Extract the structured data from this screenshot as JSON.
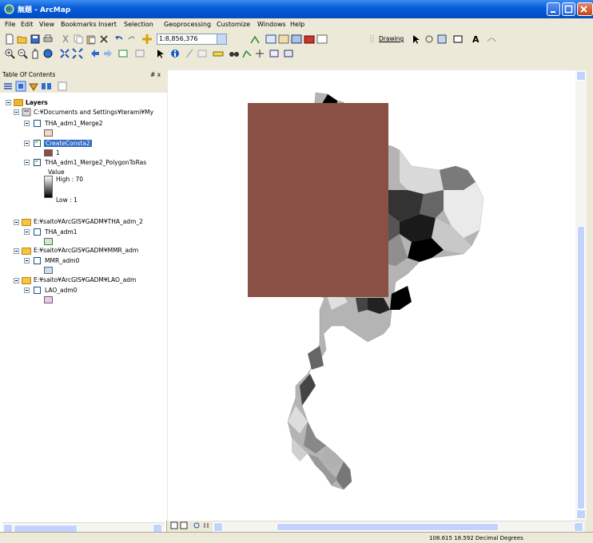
{
  "window": {
    "title": "無題 - ArcMap",
    "colors": {
      "titlebar": "#0a5fd9",
      "selection": "#316ac5",
      "raster": "#8b5045"
    }
  },
  "menu": [
    "File",
    "Edit",
    "View",
    "Bookmarks",
    "Insert",
    "Selection",
    "Geoprocessing",
    "Customize",
    "Windows",
    "Help"
  ],
  "toolbar": {
    "scale": "1:8,856,376",
    "drawing_label": "Drawing"
  },
  "toc": {
    "title": "Table Of Contents",
    "pin": "# x",
    "root_label": "Layers",
    "groups": [
      {
        "path": "C:¥Documents and Settings¥terami¥My",
        "layers": [
          {
            "name": "THA_adm1_Merge2",
            "checked": false,
            "swatch": "#f5d5c3"
          },
          {
            "name": "CreateConsta2",
            "checked": true,
            "selected": true,
            "swatch": "#8b5045",
            "value": "1"
          },
          {
            "name": "THA_adm1_Merge2_PolygonToRas",
            "checked": true,
            "legend_title": "Value",
            "high": "High : 70",
            "low": "Low : 1"
          }
        ]
      },
      {
        "path": "E:¥saito¥ArcGIS¥GADM¥THA_adm_2",
        "layers": [
          {
            "name": "THA_adm1",
            "checked": false,
            "swatch": "#c9ecc9"
          }
        ]
      },
      {
        "path": "E:¥saito¥ArcGIS¥GADM¥MMR_adm",
        "layers": [
          {
            "name": "MMR_adm0",
            "checked": false,
            "swatch": "#c6dff5"
          }
        ]
      },
      {
        "path": "E:¥saito¥ArcGIS¥GADM¥LAO_adm",
        "layers": [
          {
            "name": "LAO_adm0",
            "checked": false,
            "swatch": "#ecc9ec"
          }
        ]
      }
    ]
  },
  "status": {
    "coords": "108.615  18.592 Decimal Degrees"
  }
}
